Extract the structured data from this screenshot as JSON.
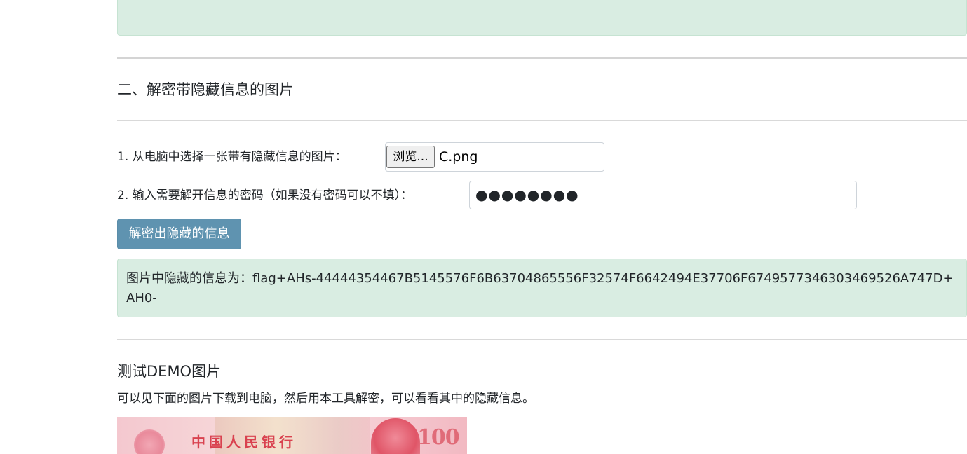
{
  "section_two": {
    "title": "二、解密带隐藏信息的图片"
  },
  "form": {
    "step1_label": "1. 从电脑中选择一张带有隐藏信息的图片：",
    "browse_label": "浏览...",
    "selected_file": "C.png",
    "step2_label": "2. 输入需要解开信息的密码（如果没有密码可以不填）：",
    "password_value": "●●●●●●●●",
    "decrypt_button": "解密出隐藏的信息"
  },
  "result": {
    "label": "图片中隐藏的信息为：",
    "value": "flag+AHs-44444354467B5145576F6B63704865556F32574F6642494E37706F674957734630346952​6A747D+AH0-"
  },
  "demo": {
    "title": "测试DEMO图片",
    "description": "可以见下面的图片下载到电脑，然后用本工具解密，可以看看其中的隐藏信息。",
    "image_text": "中国人民银行",
    "image_denomination": "100"
  },
  "colors": {
    "alert_bg": "#d9ede2",
    "button_bg": "#5f93b0"
  }
}
